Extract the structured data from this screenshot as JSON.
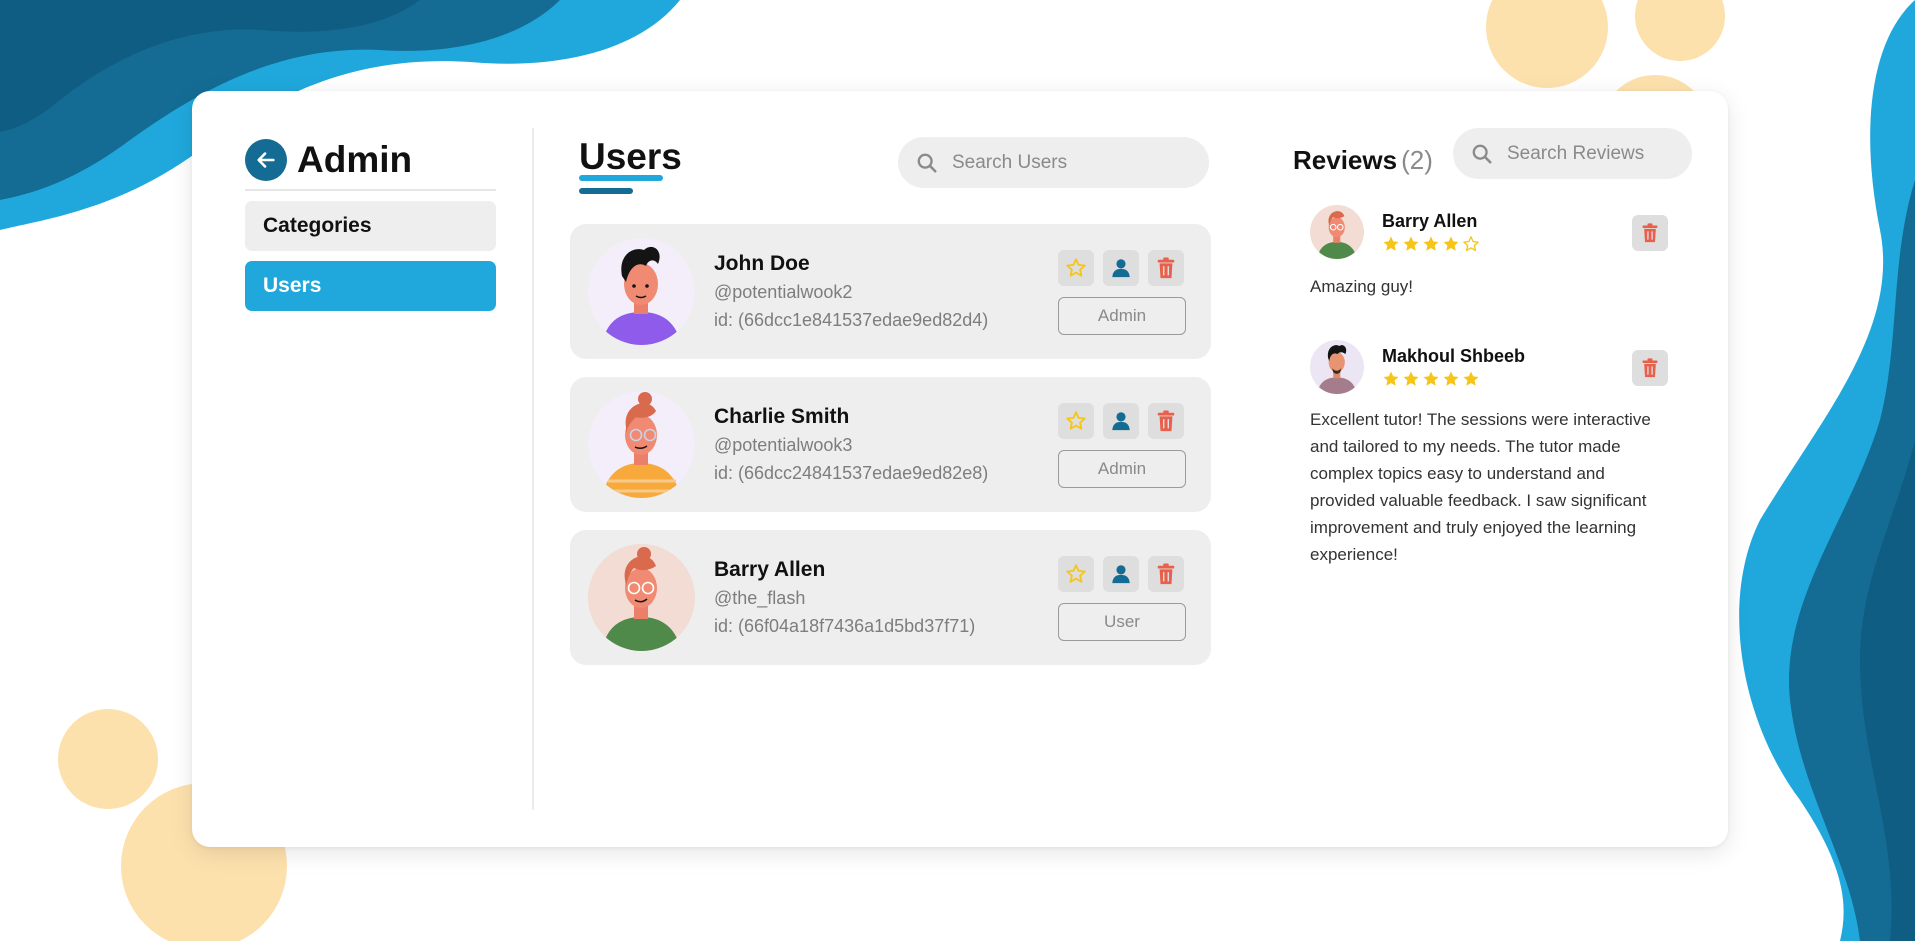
{
  "colors": {
    "primary_dark": "#146c94",
    "primary_light": "#20a8dc",
    "accent_peach": "#fde1ad",
    "star_gold": "#f5c518",
    "delete_red": "#e8604c"
  },
  "sidebar": {
    "title": "Admin",
    "back_icon": "arrow-left-icon",
    "items": [
      {
        "label": "Categories",
        "active": false
      },
      {
        "label": "Users",
        "active": true
      }
    ]
  },
  "users": {
    "title": "Users",
    "search_placeholder": "Search Users",
    "list": [
      {
        "name": "John Doe",
        "handle": "@potentialwook2",
        "id": "id: (66dcc1e841537edae9ed82d4)",
        "role": "Admin"
      },
      {
        "name": "Charlie Smith",
        "handle": "@potentialwook3",
        "id": "id: (66dcc24841537edae9ed82e8)",
        "role": "Admin"
      },
      {
        "name": "Barry Allen",
        "handle": "@the_flash",
        "id": "id: (66f04a18f7436a1d5bd37f71)",
        "role": "User"
      }
    ]
  },
  "reviews": {
    "title": "Reviews",
    "count": "(2)",
    "search_placeholder": "Search Reviews",
    "list": [
      {
        "name": "Barry Allen",
        "rating": 4,
        "max_rating": 5,
        "text": "Amazing guy!"
      },
      {
        "name": "Makhoul Shbeeb",
        "rating": 5,
        "max_rating": 5,
        "text": "Excellent tutor! The sessions were interactive and tailored to my needs. The tutor made complex topics easy to understand and provided valuable feedback. I saw significant improvement and truly enjoyed the learning experience!"
      }
    ]
  }
}
